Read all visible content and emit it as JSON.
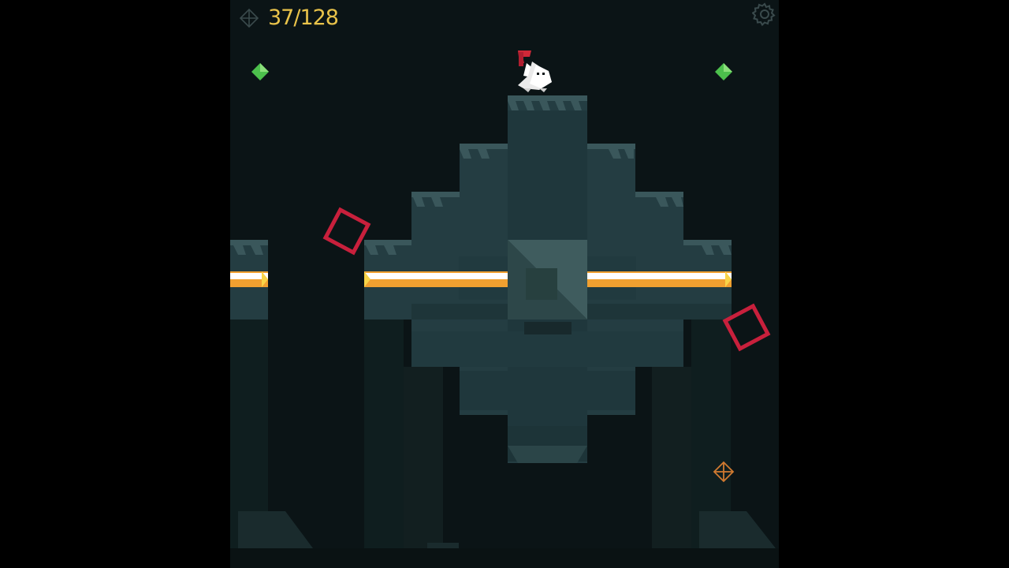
{
  "hud": {
    "collected_count": "37/128",
    "collectible_icon": "crosshair-diamond-icon",
    "settings_icon": "gear-icon"
  },
  "colors": {
    "background": "#0b1416",
    "blocks": "#243d42",
    "hud_text": "#e9c34a",
    "green_gem": "#4cc04c",
    "hazard_outline": "#c8203c",
    "beam_core": "#ffffff",
    "beam_edge": "#f0a030",
    "player_flag": "#d02838"
  }
}
